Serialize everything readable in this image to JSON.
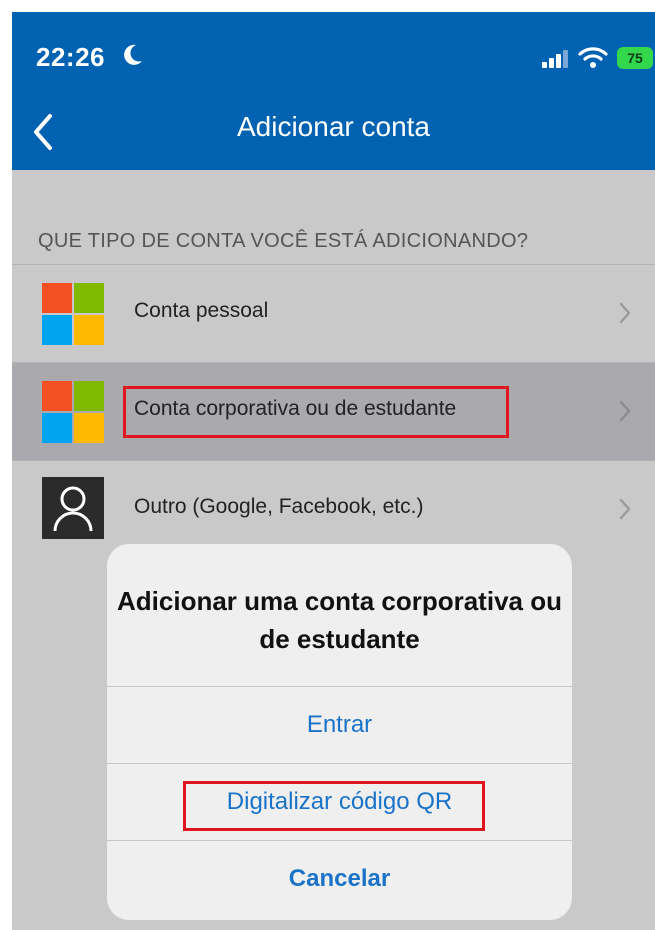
{
  "status_bar": {
    "time": "22:26",
    "battery": "75"
  },
  "nav": {
    "title": "Adicionar conta"
  },
  "list": {
    "section_header": "QUE TIPO DE CONTA VOCÊ ESTÁ ADICIONANDO?",
    "items": [
      {
        "label": "Conta pessoal",
        "icon": "microsoft-logo-icon"
      },
      {
        "label": "Conta corporativa ou de estudante",
        "icon": "microsoft-logo-icon",
        "selected": true
      },
      {
        "label": "Outro (Google, Facebook, etc.)",
        "icon": "person-icon"
      }
    ]
  },
  "sheet": {
    "title": "Adicionar uma conta corporativa ou de estudante",
    "actions": [
      {
        "label": "Entrar"
      },
      {
        "label": "Digitalizar código QR"
      },
      {
        "label": "Cancelar"
      }
    ]
  },
  "colors": {
    "header_bg": "#0062b1",
    "link_blue": "#1a73c9",
    "highlight_red": "#e0151f",
    "battery_green": "#32d74b"
  }
}
